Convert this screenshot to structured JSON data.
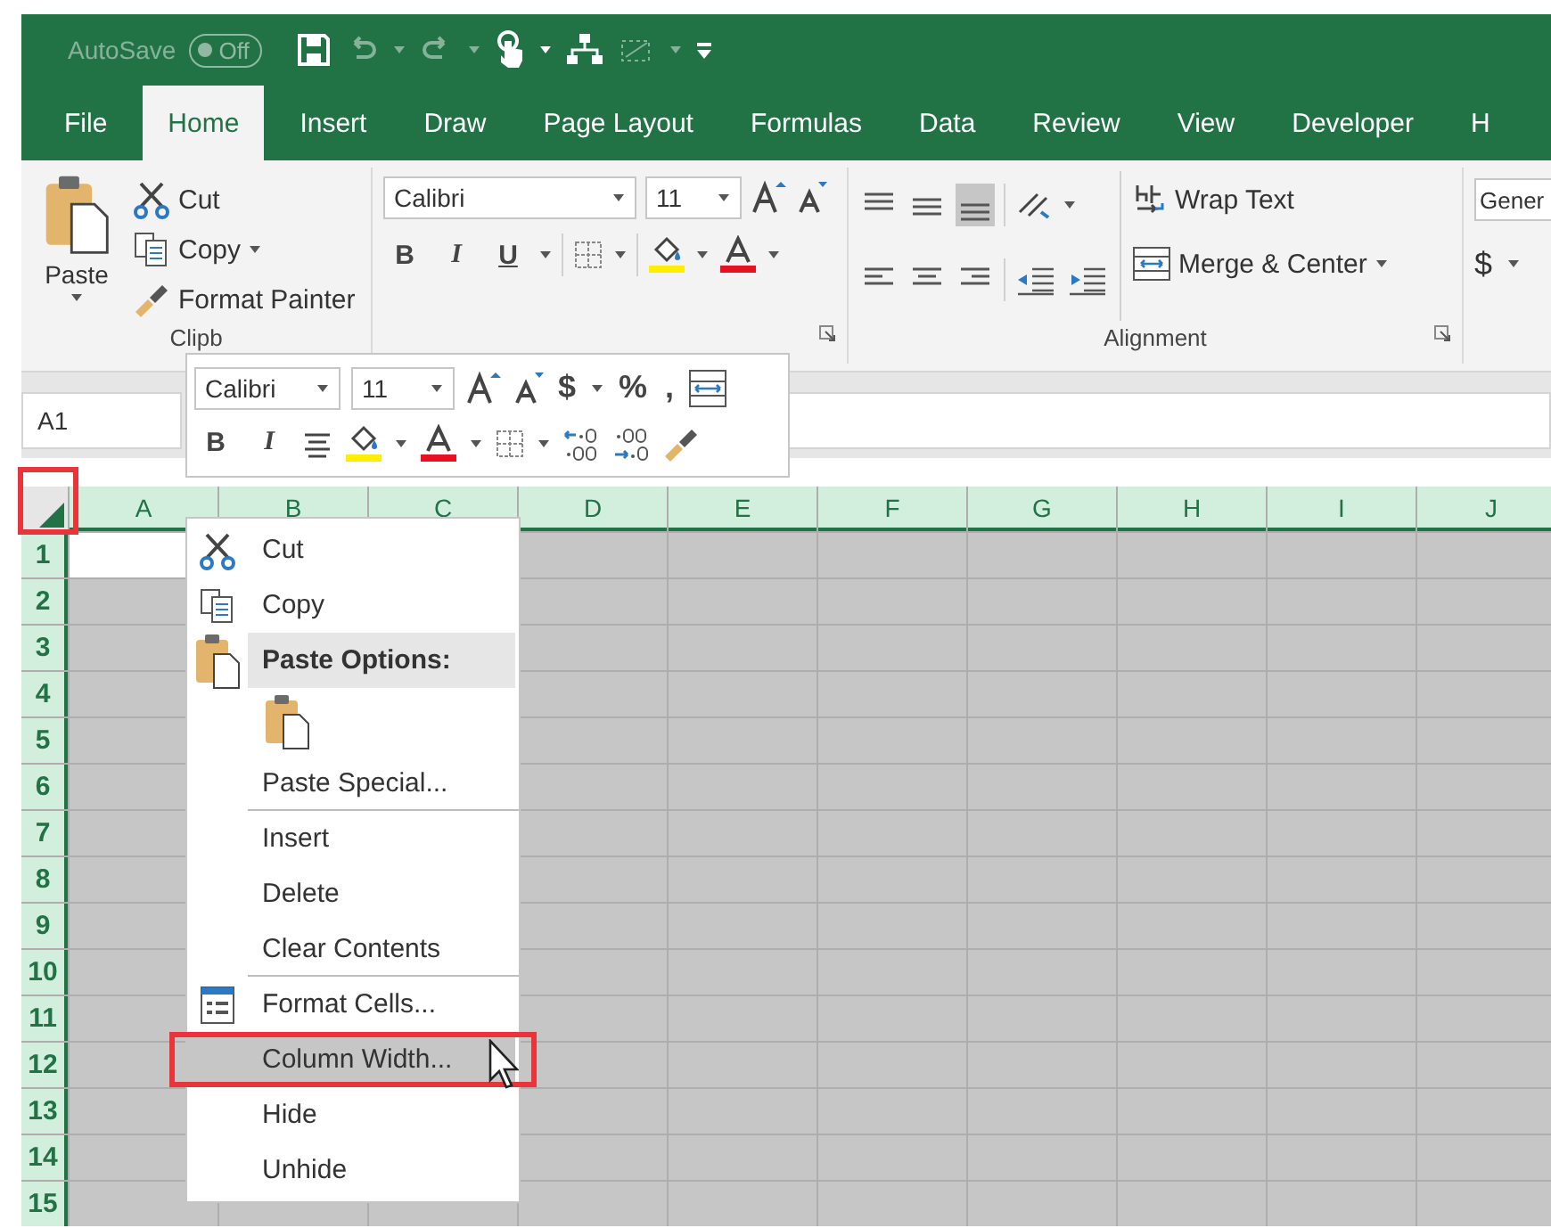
{
  "quick_access": {
    "autosave_label": "AutoSave",
    "autosave_state": "Off",
    "autosave_on": false
  },
  "tabs": [
    {
      "label": "File",
      "selected": false
    },
    {
      "label": "Home",
      "selected": true
    },
    {
      "label": "Insert",
      "selected": false
    },
    {
      "label": "Draw",
      "selected": false
    },
    {
      "label": "Page Layout",
      "selected": false
    },
    {
      "label": "Formulas",
      "selected": false
    },
    {
      "label": "Data",
      "selected": false
    },
    {
      "label": "Review",
      "selected": false
    },
    {
      "label": "View",
      "selected": false
    },
    {
      "label": "Developer",
      "selected": false
    },
    {
      "label": "H",
      "selected": false
    }
  ],
  "clipboard": {
    "paste": "Paste",
    "cut": "Cut",
    "copy": "Copy",
    "format_painter": "Format Painter",
    "label": "Clipb"
  },
  "font": {
    "name": "Calibri",
    "size": "11",
    "bold": "B",
    "italic": "I",
    "underline": "U"
  },
  "alignment": {
    "wrap_text": "Wrap Text",
    "merge_center": "Merge & Center",
    "label": "Alignment"
  },
  "number": {
    "format": "Gener",
    "currency": "$"
  },
  "name_box": "A1",
  "mini_toolbar": {
    "font": "Calibri",
    "size": "11",
    "currency": "$",
    "percent": "%",
    "comma": ",",
    "bold": "B",
    "italic": "I"
  },
  "sheet": {
    "select_all_callout": true,
    "all_selected": true,
    "columns": [
      "A",
      "B",
      "C",
      "D",
      "E",
      "F",
      "G",
      "H",
      "I",
      "J"
    ],
    "rows": [
      "1",
      "2",
      "3",
      "4",
      "5",
      "6",
      "7",
      "8",
      "9",
      "10",
      "11",
      "12",
      "13",
      "14",
      "15"
    ]
  },
  "context_menu": [
    {
      "kind": "cut",
      "label": "Cut",
      "selected": false,
      "divider": false,
      "callout": false
    },
    {
      "kind": "copy",
      "label": "Copy",
      "selected": false,
      "divider": false,
      "callout": false
    },
    {
      "kind": "header",
      "label": "Paste Options:",
      "selected": false,
      "divider": false,
      "callout": false
    },
    {
      "kind": "paste"
    },
    {
      "kind": "plain",
      "label": "Paste Special...",
      "selected": false,
      "divider": true,
      "callout": false
    },
    {
      "kind": "plain",
      "label": "Insert",
      "selected": false,
      "divider": false,
      "callout": false
    },
    {
      "kind": "plain",
      "label": "Delete",
      "selected": false,
      "divider": false,
      "callout": false
    },
    {
      "kind": "plain",
      "label": "Clear Contents",
      "selected": false,
      "divider": true,
      "callout": false
    },
    {
      "kind": "format",
      "label": "Format Cells...",
      "selected": false,
      "divider": false,
      "callout": false
    },
    {
      "kind": "plain",
      "label": "Column Width...",
      "selected": true,
      "divider": false,
      "callout": true
    },
    {
      "kind": "plain",
      "label": "Hide",
      "selected": false,
      "divider": false,
      "callout": false
    },
    {
      "kind": "plain",
      "label": "Unhide",
      "selected": false,
      "divider": false,
      "callout": false
    }
  ]
}
